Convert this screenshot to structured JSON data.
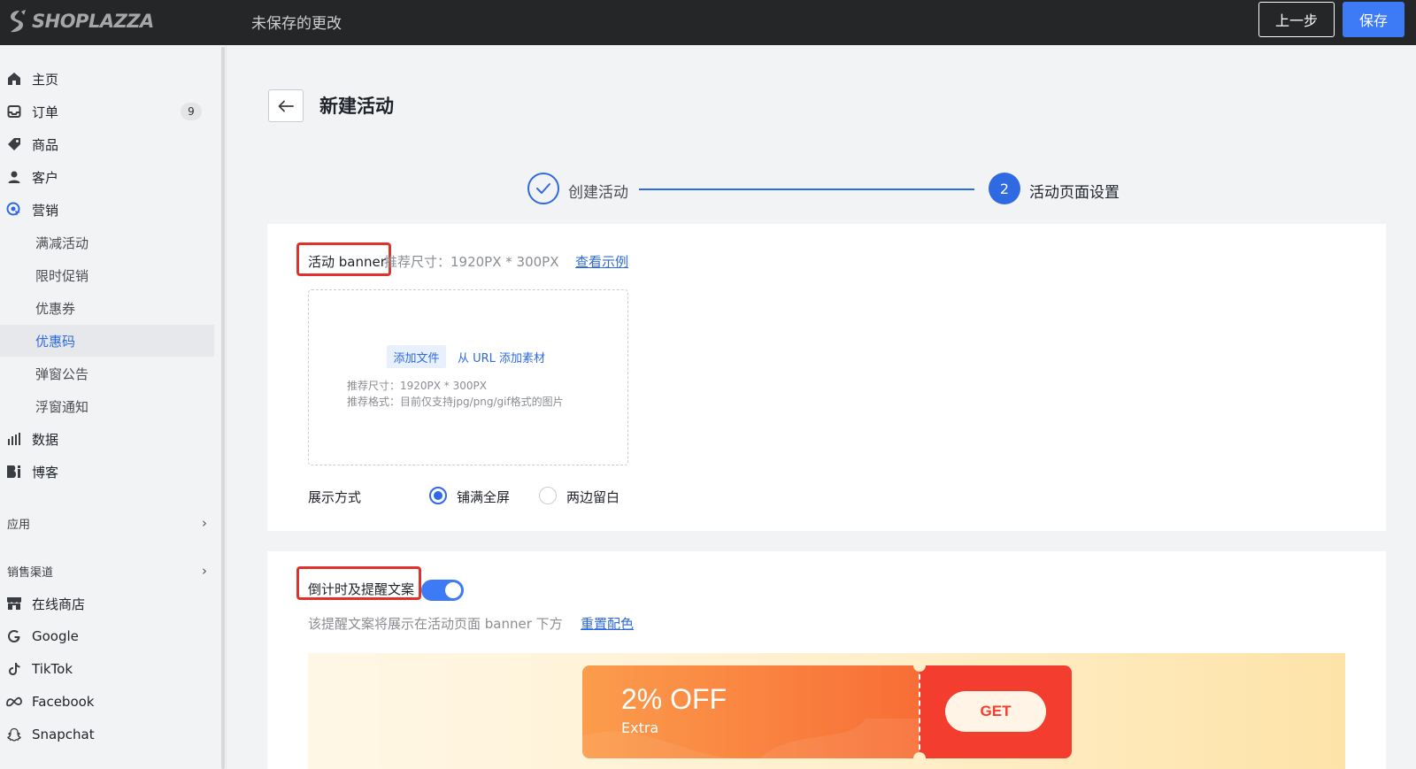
{
  "topbar": {
    "brand": "SHOPLAZZA",
    "unsaved_text": "未保存的更改",
    "prev_label": "上一步",
    "save_label": "保存"
  },
  "sidebar": {
    "items": [
      {
        "label": "主页",
        "icon": "home-icon"
      },
      {
        "label": "订单",
        "icon": "inbox-icon",
        "badge": "9"
      },
      {
        "label": "商品",
        "icon": "tag-icon"
      },
      {
        "label": "客户",
        "icon": "user-icon"
      },
      {
        "label": "营销",
        "icon": "marketing-icon"
      }
    ],
    "marketing_sub": [
      "满减活动",
      "限时促销",
      "优惠券",
      "优惠码",
      "弹窗公告",
      "浮窗通知"
    ],
    "active_sub": "优惠码",
    "items2": [
      {
        "label": "数据",
        "icon": "chart-icon"
      },
      {
        "label": "博客",
        "icon": "blog-icon"
      }
    ],
    "apps_label": "应用",
    "channels_label": "销售渠道",
    "channels": [
      {
        "label": "在线商店",
        "icon": "store-icon"
      },
      {
        "label": "Google",
        "icon": "google-icon"
      },
      {
        "label": "TikTok",
        "icon": "tiktok-icon"
      },
      {
        "label": "Facebook",
        "icon": "meta-icon"
      },
      {
        "label": "Snapchat",
        "icon": "snapchat-icon"
      }
    ]
  },
  "main": {
    "title": "新建活动",
    "steps": [
      {
        "label": "创建活动",
        "state": "done"
      },
      {
        "number": "2",
        "label": "活动页面设置",
        "state": "current"
      }
    ],
    "banner": {
      "title": "活动 banner",
      "hint": "推荐尺寸：1920PX * 300PX",
      "example_link": "查看示例",
      "add_file": "添加文件",
      "add_url": "从 URL 添加素材",
      "size_hint": "推荐尺寸：1920PX * 300PX",
      "format_hint": "推荐格式：目前仅支持jpg/png/gif格式的图片",
      "display_label": "展示方式",
      "option_full": "铺满全屏",
      "option_margin": "两边留白",
      "selected": "铺满全屏"
    },
    "countdown": {
      "title": "倒计时及提醒文案",
      "enabled": true,
      "hint": "该提醒文案将展示在活动页面 banner 下方",
      "reset_link": "重置配色"
    },
    "coupon": {
      "off": "2% OFF",
      "extra": "Extra",
      "get": "GET",
      "colors": {
        "left": "#f86e36",
        "right": "#f33d2e"
      }
    }
  }
}
